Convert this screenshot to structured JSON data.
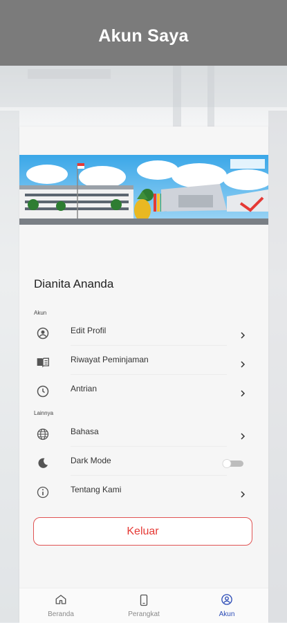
{
  "header": {
    "title": "Akun Saya"
  },
  "profile": {
    "name": "Dianita Ananda"
  },
  "sections": {
    "account_label": "Akun",
    "other_label": "Lainnya"
  },
  "account_items": [
    {
      "label": "Edit Profil",
      "icon": "user-circle-icon"
    },
    {
      "label": "Riwayat Peminjaman",
      "icon": "book-open-icon"
    },
    {
      "label": "Antrian",
      "icon": "clock-icon"
    }
  ],
  "other_items": [
    {
      "label": "Bahasa",
      "icon": "globe-icon"
    },
    {
      "label": "Dark Mode",
      "icon": "moon-icon",
      "toggle": false
    },
    {
      "label": "Tentang Kami",
      "icon": "info-icon"
    }
  ],
  "logout_label": "Keluar",
  "bottom_nav": [
    {
      "label": "Beranda",
      "icon": "home-icon",
      "active": false
    },
    {
      "label": "Perangkat",
      "icon": "device-icon",
      "active": false
    },
    {
      "label": "Akun",
      "icon": "account-icon",
      "active": true
    }
  ],
  "colors": {
    "header_bg": "#7b7b7b",
    "accent_red": "#e53935",
    "nav_active": "#2b4bb6"
  }
}
